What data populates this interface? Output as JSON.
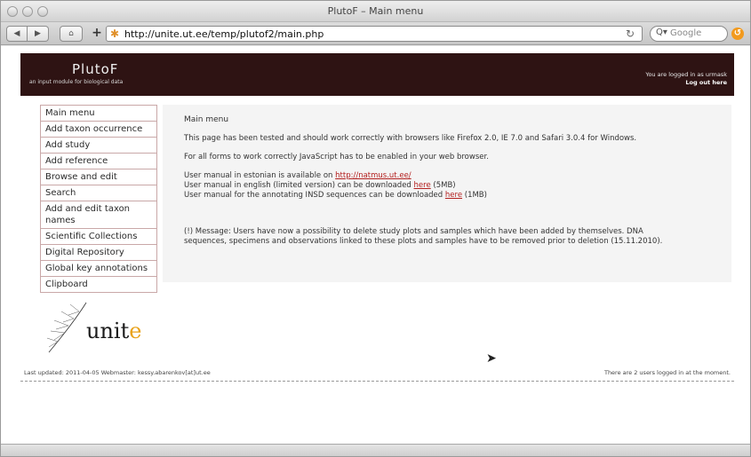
{
  "window": {
    "title": "PlutoF – Main menu"
  },
  "toolbar": {
    "back_icon": "◀",
    "forward_icon": "▶",
    "home_icon": "⌂",
    "add_icon": "+",
    "url": "http://unite.ut.ee/temp/plutof2/main.php",
    "reload_icon": "↻",
    "search_placeholder": "Google",
    "search_icon": "Q▾"
  },
  "banner": {
    "logo": "PlutoF",
    "logo_subtitle": "an input module for biological data",
    "login_status": "You are logged in as urmask",
    "logout_link": "Log out here"
  },
  "sidebar": {
    "items": [
      {
        "label": "Main menu"
      },
      {
        "label": "Add taxon occurrence"
      },
      {
        "label": "Add study"
      },
      {
        "label": "Add reference"
      },
      {
        "label": "Browse and edit"
      },
      {
        "label": "Search"
      },
      {
        "label": "Add and edit taxon names"
      },
      {
        "label": "Scientific Collections"
      },
      {
        "label": "Digital Repository"
      },
      {
        "label": "Global key annotations"
      },
      {
        "label": "Clipboard"
      }
    ]
  },
  "unite_logo": {
    "text_main": "unit",
    "text_accent": "e"
  },
  "main": {
    "title": "Main menu",
    "browser_note": "This page has been tested and should work correctly with browsers like Firefox 2.0, IE 7.0 and Safari 3.0.4 for Windows.",
    "js_note": "For all forms to work correctly JavaScript has to be enabled in your web browser.",
    "manual_estonian_prefix": "User manual in estonian is available on ",
    "manual_estonian_link": "http://natmus.ut.ee/",
    "manual_english_prefix": "User manual in english (limited version) can be downloaded ",
    "manual_english_link": "here",
    "manual_english_suffix": " (5MB)",
    "manual_insd_prefix": "User manual for the annotating INSD sequences can be downloaded ",
    "manual_insd_link": "here",
    "manual_insd_suffix": " (1MB)",
    "message_line1": "(!) Message: Users have now a possibility to delete study plots and samples which have been added by themselves. DNA",
    "message_line2": "sequences, specimens and observations linked to these plots and samples have to be removed prior to deletion (15.11.2010)."
  },
  "footer": {
    "left": "Last updated: 2011-04-05  Webmaster: kessy.abarenkov[at]ut.ee",
    "right": "There are 2 users logged in at the moment."
  }
}
